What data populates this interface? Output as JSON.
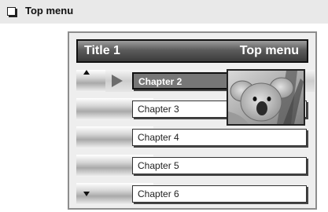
{
  "section": {
    "title": "Top menu"
  },
  "screen": {
    "title_left": "Title 1",
    "title_right": "Top menu",
    "chapters": [
      {
        "label": "Chapter 2",
        "selected": true
      },
      {
        "label": "Chapter 3",
        "selected": false
      },
      {
        "label": "Chapter 4",
        "selected": false
      },
      {
        "label": "Chapter 5",
        "selected": false
      },
      {
        "label": "Chapter 6",
        "selected": false
      }
    ]
  },
  "icons": {
    "header": "checkbox-square-icon",
    "scroll_up": "scroll-up-arrow-icon",
    "scroll_down": "scroll-down-arrow-icon",
    "current": "play-triangle-icon",
    "thumbnail": "koala-thumbnail-image"
  },
  "colors": {
    "title_bar": "#4a4a4a",
    "selected_button": "#777777",
    "header_band": "#e9e9e9"
  }
}
